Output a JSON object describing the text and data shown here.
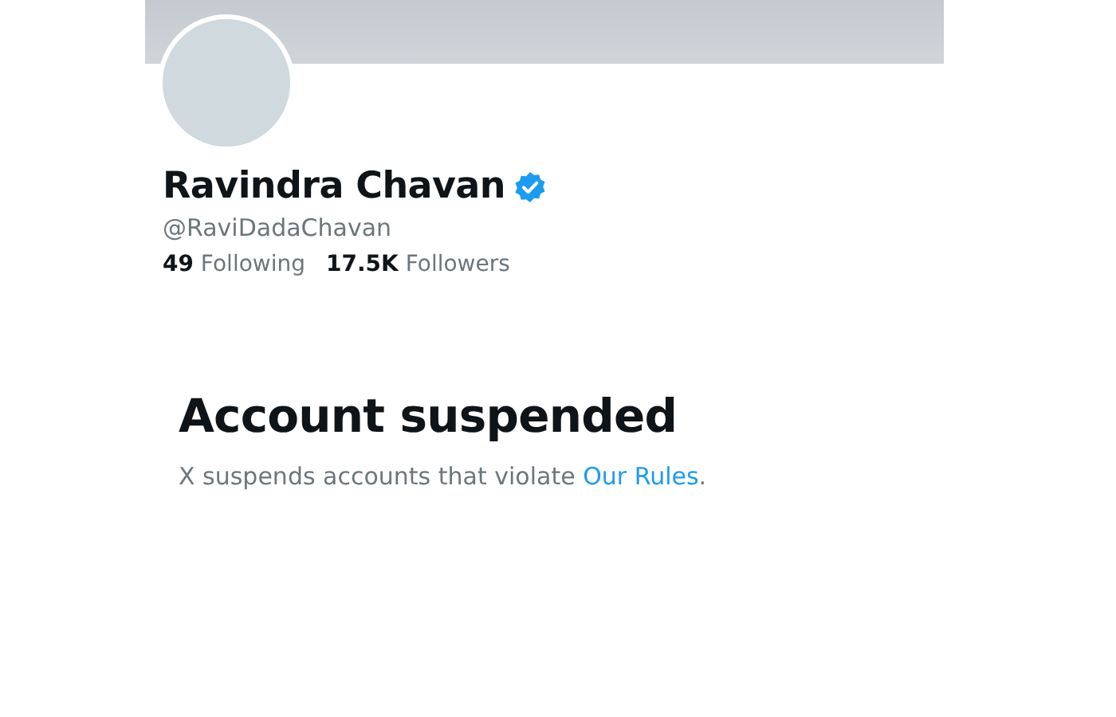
{
  "profile": {
    "name": "Ravindra Chavan",
    "verified": true,
    "handle": "@RaviDadaChavan",
    "stats": [
      {
        "text": "**49** Following"
      },
      {
        "text": "**17.5K** Followers"
      }
    ]
  },
  "suspension": {
    "title": "Account suspended",
    "message": "X suspends accounts that violate ",
    "link": "Our Rules",
    "message_end": "."
  }
}
